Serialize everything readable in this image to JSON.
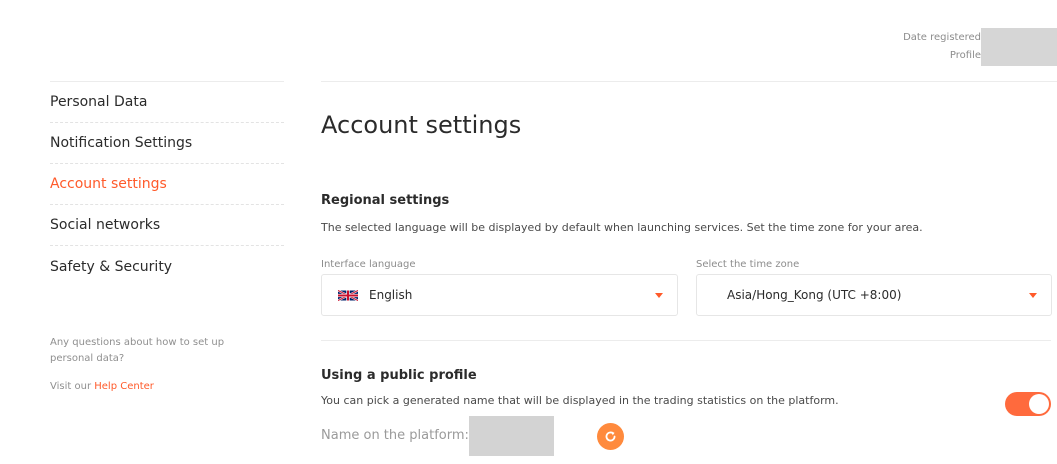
{
  "header": {
    "date_registered_label": "Date registered",
    "profile_label": "Profile"
  },
  "sidebar": {
    "items": [
      {
        "label": "Personal Data",
        "active": false
      },
      {
        "label": "Notification Settings",
        "active": false
      },
      {
        "label": "Account settings",
        "active": true
      },
      {
        "label": "Social networks",
        "active": false
      },
      {
        "label": "Safety & Security",
        "active": false
      }
    ],
    "help_text": "Any questions about how to set up personal data?",
    "help_prefix": "Visit our",
    "help_link": "Help Center"
  },
  "main": {
    "title": "Account settings",
    "regional": {
      "title": "Regional settings",
      "description": "The selected language will be displayed by default when launching services. Set the time zone for your area.",
      "language_label": "Interface language",
      "language_value": "English",
      "timezone_label": "Select the time zone",
      "timezone_value": "Asia/Hong_Kong (UTC +8:00)"
    },
    "public_profile": {
      "title": "Using a public profile",
      "description": "You can pick a generated name that will be displayed in the trading statistics on the platform.",
      "enabled": true,
      "name_label": "Name on the platform:"
    }
  },
  "colors": {
    "accent": "#ff5a2a",
    "toggle": "#ff6a3d",
    "refresh": "#ff8a3d"
  },
  "icons": {
    "flag": "uk-flag-icon",
    "caret": "caret-down-icon",
    "refresh": "refresh-icon"
  }
}
